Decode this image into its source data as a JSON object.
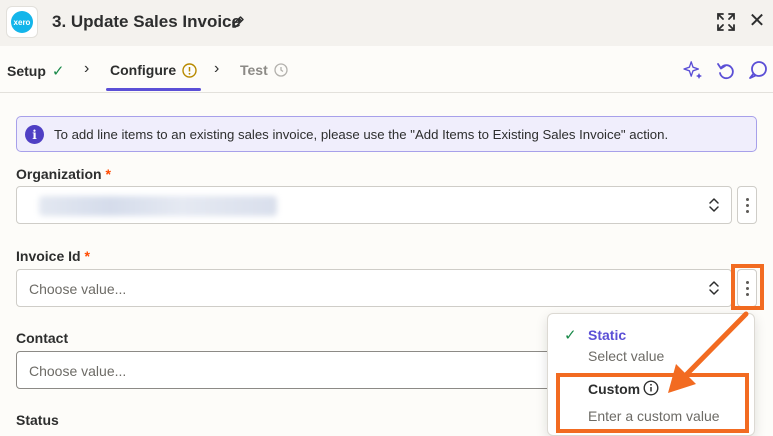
{
  "header": {
    "app_logo_text": "xero",
    "title": "3. Update Sales Invoice"
  },
  "tabs": [
    {
      "label": "Setup",
      "status": "complete"
    },
    {
      "label": "Configure",
      "status": "warning"
    },
    {
      "label": "Test",
      "status": "pending"
    }
  ],
  "banner": {
    "text": "To add line items to an existing sales invoice, please use the \"Add Items to Existing Sales Invoice\" action.",
    "icon_char": "i"
  },
  "fields": {
    "organization": {
      "label": "Organization",
      "required_mark": "*"
    },
    "invoice_id": {
      "label": "Invoice Id",
      "required_mark": "*",
      "placeholder": "Choose value..."
    },
    "contact": {
      "label": "Contact",
      "placeholder": "Choose value..."
    },
    "status": {
      "label": "Status"
    }
  },
  "dropdown": {
    "static_title": "Static",
    "static_sub": "Select value",
    "custom_title": "Custom",
    "custom_sub": "Enter a custom value"
  },
  "colors": {
    "accent": "#5b4fd6",
    "highlight": "#f26b21",
    "required": "#ff4a00",
    "logo": "#13b5ea"
  }
}
